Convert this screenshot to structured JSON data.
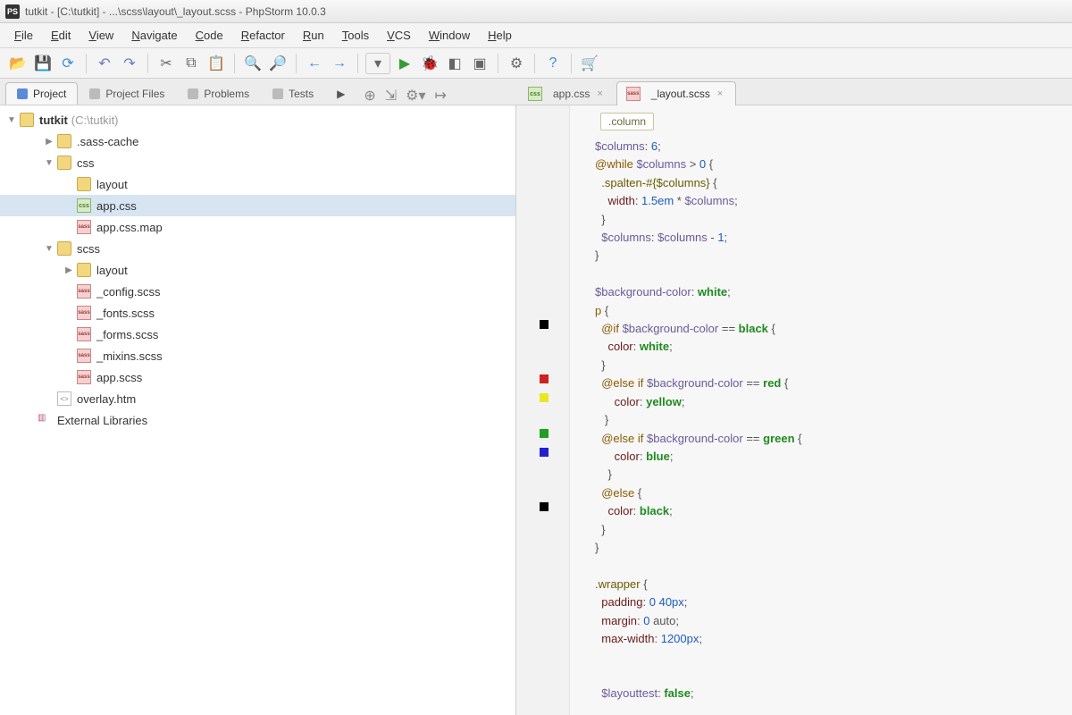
{
  "window": {
    "title": "tutkit - [C:\\tutkit] - ...\\scss\\layout\\_layout.scss - PhpStorm 10.0.3",
    "app_icon_text": "PS"
  },
  "menus": [
    "File",
    "Edit",
    "View",
    "Navigate",
    "Code",
    "Refactor",
    "Run",
    "Tools",
    "VCS",
    "Window",
    "Help"
  ],
  "tool_tabs": [
    {
      "label": "Project",
      "active": true
    },
    {
      "label": "Project Files",
      "active": false
    },
    {
      "label": "Problems",
      "active": false
    },
    {
      "label": "Tests",
      "active": false
    }
  ],
  "editor_tabs": [
    {
      "label": "app.css",
      "icon": "css",
      "active": false
    },
    {
      "label": "_layout.scss",
      "icon": "scss",
      "active": true
    }
  ],
  "tree": {
    "root": {
      "name": "tutkit",
      "path": "(C:\\tutkit)"
    },
    "items": [
      {
        "indent": 1,
        "arrow": "▶",
        "icon": "folder",
        "label": ".sass-cache"
      },
      {
        "indent": 1,
        "arrow": "▼",
        "icon": "folder",
        "label": "css"
      },
      {
        "indent": 2,
        "arrow": "",
        "icon": "folder",
        "label": "layout"
      },
      {
        "indent": 2,
        "arrow": "",
        "icon": "css",
        "label": "app.css",
        "selected": true
      },
      {
        "indent": 2,
        "arrow": "",
        "icon": "scss",
        "label": "app.css.map"
      },
      {
        "indent": 1,
        "arrow": "▼",
        "icon": "folder",
        "label": "scss"
      },
      {
        "indent": 2,
        "arrow": "▶",
        "icon": "folder",
        "label": "layout"
      },
      {
        "indent": 2,
        "arrow": "",
        "icon": "scss",
        "label": "_config.scss"
      },
      {
        "indent": 2,
        "arrow": "",
        "icon": "scss",
        "label": "_fonts.scss"
      },
      {
        "indent": 2,
        "arrow": "",
        "icon": "scss",
        "label": "_forms.scss"
      },
      {
        "indent": 2,
        "arrow": "",
        "icon": "scss",
        "label": "_mixins.scss"
      },
      {
        "indent": 2,
        "arrow": "",
        "icon": "scss",
        "label": "app.scss"
      },
      {
        "indent": 1,
        "arrow": "",
        "icon": "htm",
        "label": "overlay.htm"
      },
      {
        "indent": 0,
        "arrow": "",
        "icon": "lib",
        "label": "External Libraries"
      }
    ]
  },
  "breadcrumb": ".column",
  "gutter_colors": [
    {
      "line": 10,
      "color": "#000000"
    },
    {
      "line": 13,
      "color": "#d02020"
    },
    {
      "line": 14,
      "color": "#e8e820"
    },
    {
      "line": 16,
      "color": "#20a020"
    },
    {
      "line": 17,
      "color": "#2020d0"
    },
    {
      "line": 20,
      "color": "#000000"
    }
  ],
  "code_lines": [
    [
      {
        "t": "var",
        "v": "$columns"
      },
      {
        "t": "punc",
        "v": ": "
      },
      {
        "t": "num",
        "v": "6"
      },
      {
        "t": "punc",
        "v": ";"
      }
    ],
    [
      {
        "t": "kw",
        "v": "@while"
      },
      {
        "t": "punc",
        "v": " "
      },
      {
        "t": "var",
        "v": "$columns"
      },
      {
        "t": "punc",
        "v": " > "
      },
      {
        "t": "num",
        "v": "0"
      },
      {
        "t": "punc",
        "v": " {"
      }
    ],
    [
      {
        "t": "punc",
        "v": "  "
      },
      {
        "t": "sel",
        "v": ".spalten-#{$columns}"
      },
      {
        "t": "punc",
        "v": " {"
      }
    ],
    [
      {
        "t": "punc",
        "v": "    "
      },
      {
        "t": "prop",
        "v": "width"
      },
      {
        "t": "punc",
        "v": ": "
      },
      {
        "t": "num",
        "v": "1.5em"
      },
      {
        "t": "punc",
        "v": " * "
      },
      {
        "t": "var",
        "v": "$columns"
      },
      {
        "t": "punc",
        "v": ";"
      }
    ],
    [
      {
        "t": "punc",
        "v": "  }"
      }
    ],
    [
      {
        "t": "punc",
        "v": "  "
      },
      {
        "t": "var",
        "v": "$columns"
      },
      {
        "t": "punc",
        "v": ": "
      },
      {
        "t": "var",
        "v": "$columns"
      },
      {
        "t": "punc",
        "v": " - "
      },
      {
        "t": "num",
        "v": "1"
      },
      {
        "t": "punc",
        "v": ";"
      }
    ],
    [
      {
        "t": "punc",
        "v": "}"
      }
    ],
    [],
    [
      {
        "t": "var",
        "v": "$background-color"
      },
      {
        "t": "punc",
        "v": ": "
      },
      {
        "t": "str",
        "v": "white"
      },
      {
        "t": "punc",
        "v": ";"
      }
    ],
    [
      {
        "t": "kw",
        "v": "p"
      },
      {
        "t": "punc",
        "v": " {"
      }
    ],
    [
      {
        "t": "punc",
        "v": "  "
      },
      {
        "t": "kw",
        "v": "@if"
      },
      {
        "t": "punc",
        "v": " "
      },
      {
        "t": "var",
        "v": "$background-color"
      },
      {
        "t": "punc",
        "v": " == "
      },
      {
        "t": "str",
        "v": "black"
      },
      {
        "t": "punc",
        "v": " {"
      }
    ],
    [
      {
        "t": "punc",
        "v": "    "
      },
      {
        "t": "prop",
        "v": "color"
      },
      {
        "t": "punc",
        "v": ": "
      },
      {
        "t": "str",
        "v": "white"
      },
      {
        "t": "punc",
        "v": ";"
      }
    ],
    [
      {
        "t": "punc",
        "v": "  }"
      }
    ],
    [
      {
        "t": "punc",
        "v": "  "
      },
      {
        "t": "kw",
        "v": "@else if"
      },
      {
        "t": "punc",
        "v": " "
      },
      {
        "t": "var",
        "v": "$background-color"
      },
      {
        "t": "punc",
        "v": " == "
      },
      {
        "t": "str",
        "v": "red"
      },
      {
        "t": "punc",
        "v": " {"
      }
    ],
    [
      {
        "t": "punc",
        "v": "      "
      },
      {
        "t": "prop",
        "v": "color"
      },
      {
        "t": "punc",
        "v": ": "
      },
      {
        "t": "str",
        "v": "yellow"
      },
      {
        "t": "punc",
        "v": ";"
      }
    ],
    [
      {
        "t": "punc",
        "v": "   }"
      }
    ],
    [
      {
        "t": "punc",
        "v": "  "
      },
      {
        "t": "kw",
        "v": "@else if"
      },
      {
        "t": "punc",
        "v": " "
      },
      {
        "t": "var",
        "v": "$background-color"
      },
      {
        "t": "punc",
        "v": " == "
      },
      {
        "t": "str",
        "v": "green"
      },
      {
        "t": "punc",
        "v": " {"
      }
    ],
    [
      {
        "t": "punc",
        "v": "      "
      },
      {
        "t": "prop",
        "v": "color"
      },
      {
        "t": "punc",
        "v": ": "
      },
      {
        "t": "str",
        "v": "blue"
      },
      {
        "t": "punc",
        "v": ";"
      }
    ],
    [
      {
        "t": "punc",
        "v": "    }"
      }
    ],
    [
      {
        "t": "punc",
        "v": "  "
      },
      {
        "t": "kw",
        "v": "@else"
      },
      {
        "t": "punc",
        "v": " {"
      }
    ],
    [
      {
        "t": "punc",
        "v": "    "
      },
      {
        "t": "prop",
        "v": "color"
      },
      {
        "t": "punc",
        "v": ": "
      },
      {
        "t": "str",
        "v": "black"
      },
      {
        "t": "punc",
        "v": ";"
      }
    ],
    [
      {
        "t": "punc",
        "v": "  }"
      }
    ],
    [
      {
        "t": "punc",
        "v": "}"
      }
    ],
    [],
    [
      {
        "t": "sel",
        "v": ".wrapper"
      },
      {
        "t": "punc",
        "v": " {"
      }
    ],
    [
      {
        "t": "punc",
        "v": "  "
      },
      {
        "t": "prop",
        "v": "padding"
      },
      {
        "t": "punc",
        "v": ": "
      },
      {
        "t": "num",
        "v": "0 40px"
      },
      {
        "t": "punc",
        "v": ";"
      }
    ],
    [
      {
        "t": "punc",
        "v": "  "
      },
      {
        "t": "prop",
        "v": "margin"
      },
      {
        "t": "punc",
        "v": ": "
      },
      {
        "t": "num",
        "v": "0"
      },
      {
        "t": "punc",
        "v": " auto;"
      }
    ],
    [
      {
        "t": "punc",
        "v": "  "
      },
      {
        "t": "prop",
        "v": "max-width"
      },
      {
        "t": "punc",
        "v": ": "
      },
      {
        "t": "num",
        "v": "1200px"
      },
      {
        "t": "punc",
        "v": ";"
      }
    ],
    [],
    [],
    [
      {
        "t": "punc",
        "v": "  "
      },
      {
        "t": "var",
        "v": "$layouttest"
      },
      {
        "t": "punc",
        "v": ": "
      },
      {
        "t": "str",
        "v": "false"
      },
      {
        "t": "punc",
        "v": ";"
      }
    ]
  ]
}
